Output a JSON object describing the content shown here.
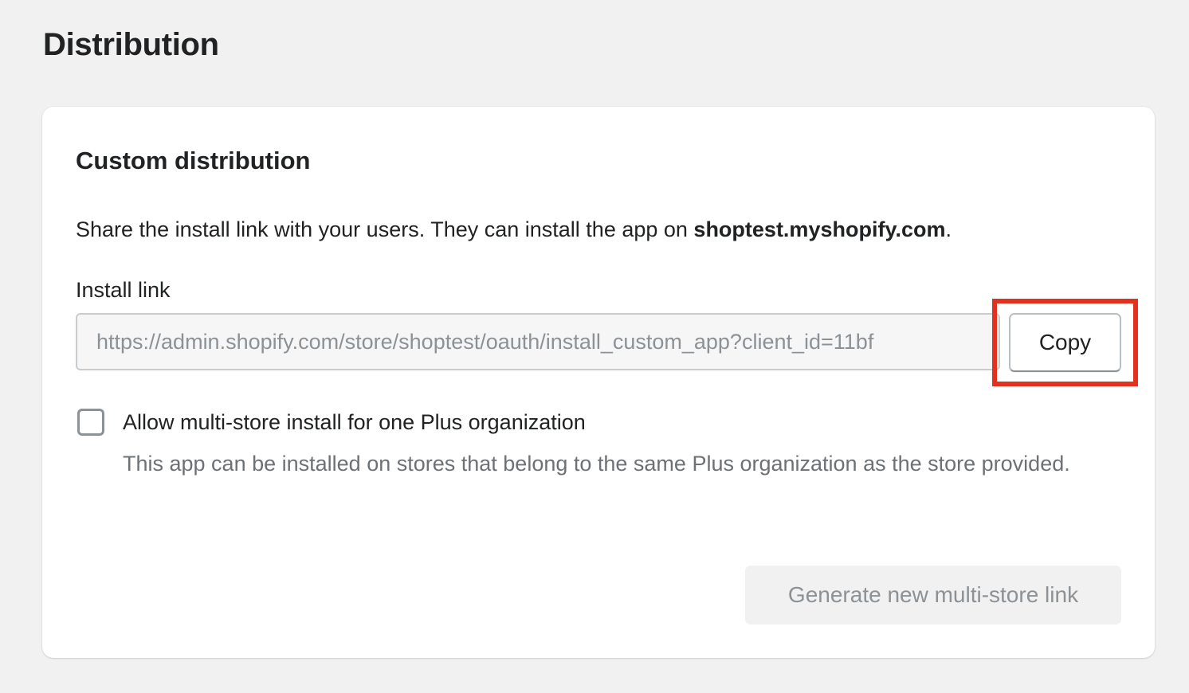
{
  "page": {
    "title": "Distribution"
  },
  "card": {
    "title": "Custom distribution",
    "description_prefix": "Share the install link with your users. They can install the app on ",
    "store_domain": "shoptest.myshopify.com",
    "description_suffix": "."
  },
  "install_link": {
    "label": "Install link",
    "value": "https://admin.shopify.com/store/shoptest/oauth/install_custom_app?client_id=11bf",
    "copy_label": "Copy"
  },
  "multi_store": {
    "checkbox_checked": false,
    "label": "Allow multi-store install for one Plus organization",
    "help_text": "This app can be installed on stores that belong to the same Plus organization as the store provided."
  },
  "actions": {
    "generate_label": "Generate new multi-store link",
    "generate_disabled": true
  },
  "colors": {
    "highlight": "#e0321f",
    "page_background": "#f1f1f1",
    "card_background": "#ffffff"
  }
}
